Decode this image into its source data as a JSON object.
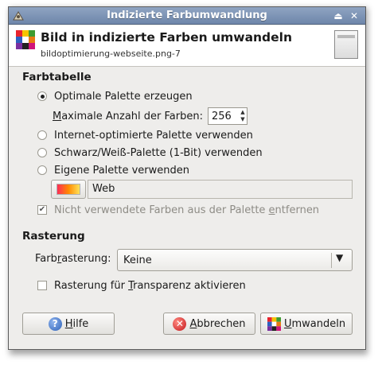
{
  "window": {
    "title": "Indizierte Farbumwandlung"
  },
  "header": {
    "title": "Bild in indizierte Farben umwandeln",
    "subtitle": "bildoptimierung-webseite.png-7"
  },
  "colormap": {
    "section_title": "Farbtabelle",
    "options": [
      {
        "label": "Optimale Palette erzeugen",
        "checked": true
      },
      {
        "label": "Internet-optimierte Palette verwenden",
        "checked": false
      },
      {
        "label": "Schwarz/Weiß-Palette (1-Bit) verwenden",
        "checked": false
      },
      {
        "label": "Eigene Palette verwenden",
        "checked": false
      }
    ],
    "max_colors_label_pre": "",
    "max_colors_label_u": "M",
    "max_colors_label_post": "aximale Anzahl der Farben:",
    "max_colors_value": "256",
    "palette_name": "Web",
    "remove_unused_pre": "Nicht verwendete Farben aus der Palette ",
    "remove_unused_u": "e",
    "remove_unused_post": "ntfernen"
  },
  "dithering": {
    "section_title": "Rasterung",
    "label_pre": "Farb",
    "label_u": "r",
    "label_post": "asterung:",
    "selected": "Keine",
    "transparency_pre": "Rasterung für ",
    "transparency_u": "T",
    "transparency_post": "ransparenz aktivieren"
  },
  "buttons": {
    "help_u": "H",
    "help_rest": "ilfe",
    "cancel_u": "A",
    "cancel_rest": "bbrechen",
    "convert_u": "U",
    "convert_rest": "mwandeln"
  },
  "icons": {
    "app": "wilber-icon",
    "shade": "shade-icon",
    "close": "close-icon",
    "palette": "palette-icon",
    "help": "help-icon",
    "cancel": "cancel-icon",
    "convert": "convert-icon"
  }
}
